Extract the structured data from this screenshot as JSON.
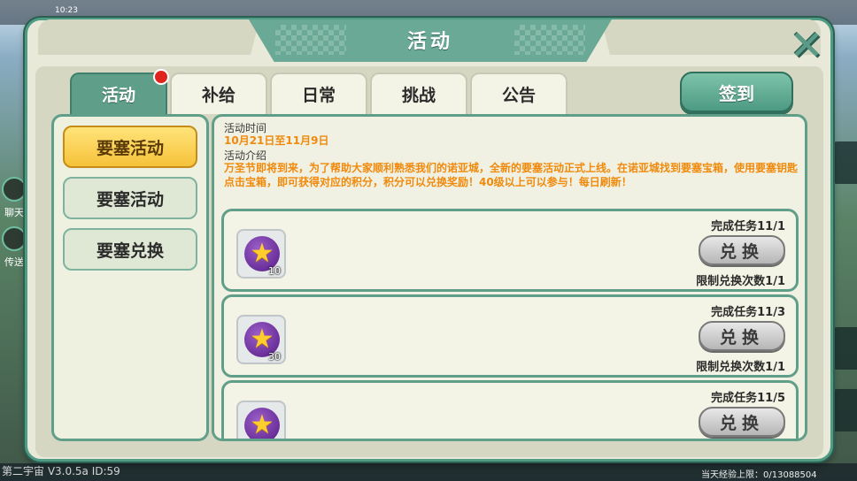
{
  "background": {
    "status_time": "10:23",
    "version": "第二宇宙 V3.0.5a  ID:59",
    "exp_text": "当天经验上限：0/13088504",
    "chat_label": "聊天",
    "send_label": "传送"
  },
  "header": {
    "title": "活动"
  },
  "tabs": [
    {
      "label": "活动",
      "active": true,
      "has_notification": true
    },
    {
      "label": "补给",
      "active": false
    },
    {
      "label": "日常",
      "active": false
    },
    {
      "label": "挑战",
      "active": false
    },
    {
      "label": "公告",
      "active": false
    }
  ],
  "signin": {
    "label": "签到"
  },
  "side_menu": [
    {
      "label": "要塞活动",
      "selected": true
    },
    {
      "label": "要塞活动",
      "selected": false
    },
    {
      "label": "要塞兑换",
      "selected": false
    }
  ],
  "info": {
    "time_label": "活动时间",
    "time_value": "10月21日至11月9日",
    "intro_label": "活动介绍",
    "intro_text": "万圣节即将到来，为了帮助大家顺利熟悉我们的诺亚城，全新的要塞活动正式上线。在诺亚城找到要塞宝箱，使用要塞钥匙点击宝箱，即可获得对应的积分，积分可以兑换奖励！40级以上可以参与！每日刷新！"
  },
  "rewards": [
    {
      "quantity": "10",
      "task": "完成任务11/1",
      "button": "兑换",
      "limit": "限制兑换次数1/1"
    },
    {
      "quantity": "30",
      "task": "完成任务11/3",
      "button": "兑换",
      "limit": "限制兑换次数1/1"
    },
    {
      "quantity": "",
      "task": "完成任务11/5",
      "button": "兑换",
      "limit": ""
    }
  ],
  "icons": {
    "close": "close-icon",
    "reward": "star-coin-icon"
  },
  "colors": {
    "accent": "#5f9f8a",
    "highlight_text": "#ef8a0c",
    "selected_menu": "#f6c23a",
    "notification": "#e0241d"
  }
}
